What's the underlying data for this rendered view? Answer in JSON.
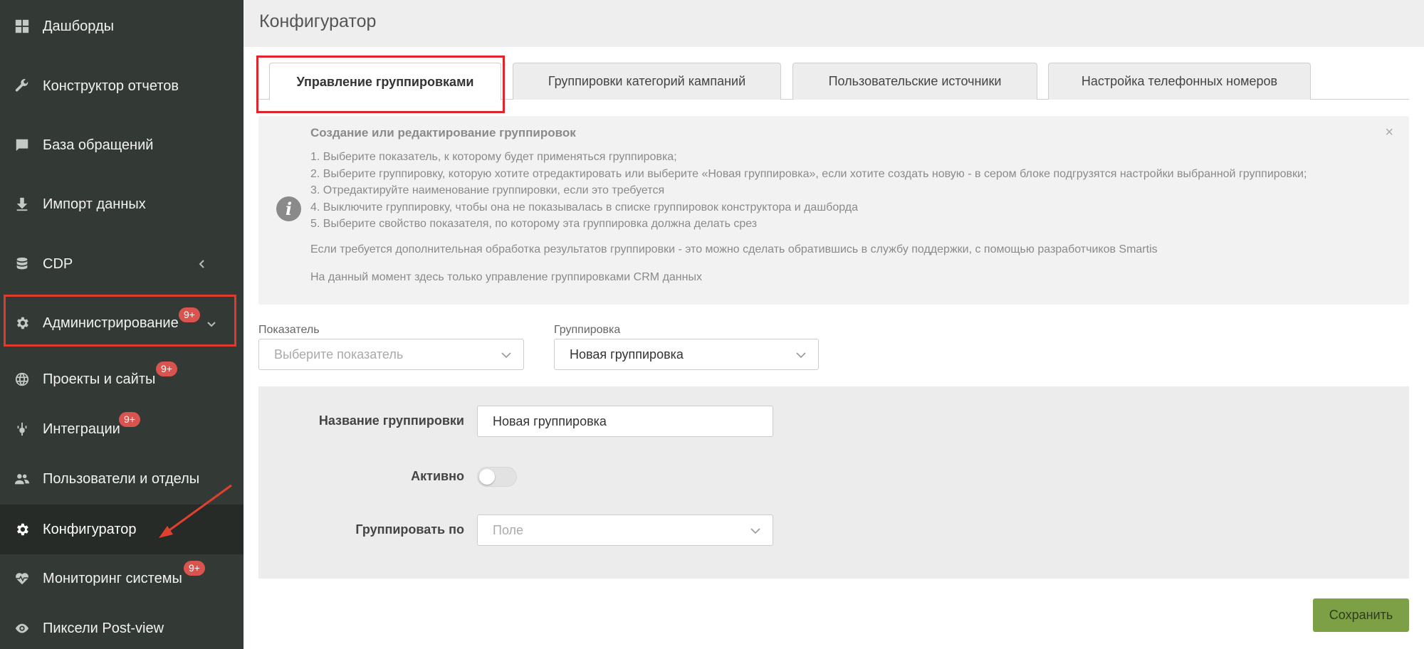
{
  "sidebar": {
    "items": [
      {
        "label": "Дашборды",
        "icon": "grid-icon"
      },
      {
        "label": "Конструктор отчетов",
        "icon": "wrench-icon"
      },
      {
        "label": "База обращений",
        "icon": "chat-icon"
      },
      {
        "label": "Импорт данных",
        "icon": "download-icon"
      },
      {
        "label": "CDP",
        "icon": "database-icon"
      },
      {
        "label": "Администрирование",
        "icon": "gear-icon",
        "badge": "9+"
      },
      {
        "label": "Проекты и сайты",
        "icon": "globe-icon",
        "badge": "9+"
      },
      {
        "label": "Интеграции",
        "icon": "plug-icon",
        "badge": "9+"
      },
      {
        "label": "Пользователи и отделы",
        "icon": "users-icon"
      },
      {
        "label": "Конфигуратор",
        "icon": "gear-icon"
      },
      {
        "label": "Мониторинг системы",
        "icon": "heartbeat-icon",
        "badge": "9+"
      },
      {
        "label": "Пиксели Post-view",
        "icon": "eye-icon"
      }
    ]
  },
  "header": {
    "title": "Конфигуратор"
  },
  "tabs": [
    {
      "label": "Управление группировками"
    },
    {
      "label": "Группировки категорий кампаний"
    },
    {
      "label": "Пользовательские источники"
    },
    {
      "label": "Настройка телефонных номеров"
    }
  ],
  "info": {
    "title": "Создание или редактирование группировок",
    "steps": [
      "1. Выберите показатель, к которому будет применяться группировка;",
      "2. Выберите группировку, которую хотите отредактировать или выберите «Новая группировка», если хотите создать новую - в сером блоке подгрузятся настройки выбранной группировки;",
      "3. Отредактируйте наименование группировки, если это требуется",
      "4. Выключите группировку, чтобы она не показывалась в списке группировок конструктора и дашборда",
      "5. Выберите свойство показателя, по которому эта группировка должна делать срез"
    ],
    "note1": "Если требуется дополнительная обработка результатов группировки - это можно сделать обратившись в службу поддержки, с помощью разработчиков Smartis",
    "note2": "На данный момент здесь только управление группировками CRM данных",
    "close": "×"
  },
  "filters": {
    "metric_label": "Показатель",
    "metric_placeholder": "Выберите показатель",
    "grouping_label": "Группировка",
    "grouping_value": "Новая группировка"
  },
  "form": {
    "name_label": "Название группировки",
    "name_value": "Новая группировка",
    "active_label": "Активно",
    "group_by_label": "Группировать по",
    "group_by_placeholder": "Поле"
  },
  "save_label": "Сохранить",
  "colors": {
    "sidebar_bg": "#333a35",
    "active_bg": "#262b27",
    "badge": "#d9534f",
    "highlight": "#e0252a",
    "save": "#7da046"
  }
}
